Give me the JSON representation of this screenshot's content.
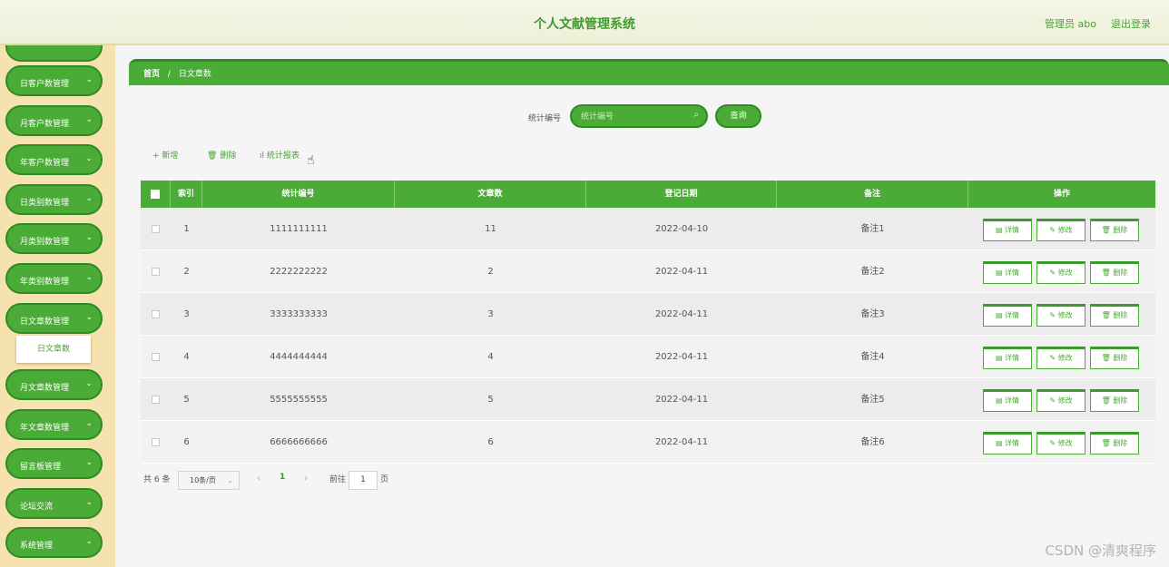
{
  "header": {
    "title": "个人文献管理系统",
    "user": "管理员 abo",
    "logout": "退出登录"
  },
  "sidebar": {
    "items": [
      {
        "label": "日客户数管理"
      },
      {
        "label": "月客户数管理"
      },
      {
        "label": "年客户数管理"
      },
      {
        "label": "日类别数管理"
      },
      {
        "label": "月类别数管理"
      },
      {
        "label": "年类别数管理"
      },
      {
        "label": "日文章数管理"
      },
      {
        "label": "月文章数管理"
      },
      {
        "label": "年文章数管理"
      },
      {
        "label": "留言板管理"
      },
      {
        "label": "论坛交流"
      },
      {
        "label": "系统管理"
      }
    ],
    "submenu": "日文章数"
  },
  "breadcrumb": {
    "home": "首页",
    "sep": "/",
    "current": "日文章数"
  },
  "search": {
    "label": "统计编号",
    "placeholder": "统计编号",
    "button": "查询"
  },
  "toolbar": {
    "add": "新增",
    "delete": "删除",
    "report": "统计报表"
  },
  "table": {
    "headers": [
      "索引",
      "统计编号",
      "文章数",
      "登记日期",
      "备注",
      "操作"
    ],
    "rows": [
      {
        "index": "1",
        "code": "1111111111",
        "count": "11",
        "date": "2022-04-10",
        "note": "备注1"
      },
      {
        "index": "2",
        "code": "2222222222",
        "count": "2",
        "date": "2022-04-11",
        "note": "备注2"
      },
      {
        "index": "3",
        "code": "3333333333",
        "count": "3",
        "date": "2022-04-11",
        "note": "备注3"
      },
      {
        "index": "4",
        "code": "4444444444",
        "count": "4",
        "date": "2022-04-11",
        "note": "备注4"
      },
      {
        "index": "5",
        "code": "5555555555",
        "count": "5",
        "date": "2022-04-11",
        "note": "备注5"
      },
      {
        "index": "6",
        "code": "6666666666",
        "count": "6",
        "date": "2022-04-11",
        "note": "备注6"
      }
    ],
    "actions": {
      "detail": "详情",
      "edit": "修改",
      "delete": "删除"
    }
  },
  "pagination": {
    "total": "共 6 条",
    "page_size": "10条/页",
    "current_page": "1",
    "goto_label": "前往",
    "goto_value": "1",
    "page_suffix": "页"
  },
  "watermark": "CSDN @清爽程序",
  "colors": {
    "primary": "#4aac36",
    "primary_dark": "#2f8a24",
    "sidebar_bg": "#f6e2ae"
  }
}
